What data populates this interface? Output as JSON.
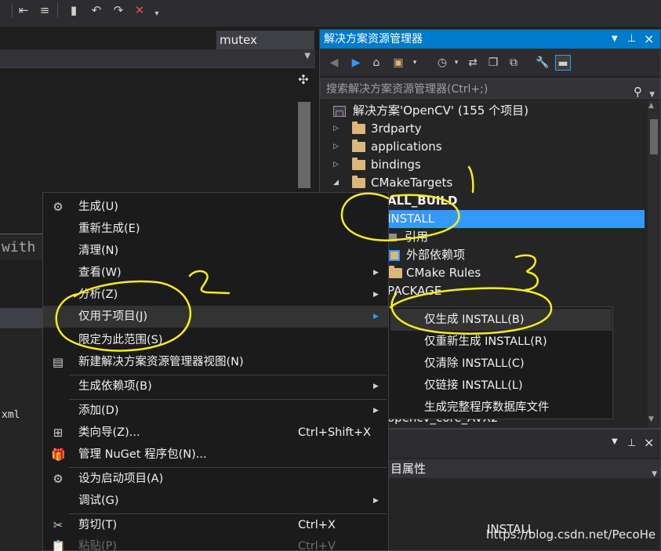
{
  "toolbar": {
    "icons": [
      "indent-icon",
      "comment-icon",
      "bookmark-icon",
      "bookmark-prev-icon",
      "bookmark-next-icon",
      "bookmark-clear-icon",
      "toolbar-overflow-icon"
    ]
  },
  "editor": {
    "tab_label": "mutex",
    "code_fragment": "with",
    "xml_fragment": "xml"
  },
  "solution_explorer": {
    "title": "解决方案资源管理器",
    "search_placeholder": "搜索解决方案资源管理器(Ctrl+;)",
    "tree": [
      {
        "label": "解决方案'OpenCV' (155 个项目)",
        "kind": "solution"
      },
      {
        "label": "3rdparty",
        "kind": "folder"
      },
      {
        "label": "applications",
        "kind": "folder"
      },
      {
        "label": "bindings",
        "kind": "folder"
      },
      {
        "label": "CMakeTargets",
        "kind": "folder"
      },
      {
        "label": "ALL_BUILD",
        "kind": "project"
      },
      {
        "label": "INSTALL",
        "kind": "project",
        "selected": true
      },
      {
        "label": "引用",
        "kind": "references"
      },
      {
        "label": "外部依赖项",
        "kind": "external"
      },
      {
        "label": "CMake Rules",
        "kind": "folder"
      },
      {
        "label": "PACKAGE",
        "kind": "project"
      },
      {
        "label": "opencv_core_AVX2",
        "kind": "project"
      }
    ]
  },
  "properties": {
    "dropdown_label": "目属性",
    "object_name": "INSTALL"
  },
  "context_menu": {
    "items": [
      {
        "label": "生成(U)",
        "icon": "build-icon"
      },
      {
        "label": "重新生成(E)"
      },
      {
        "label": "清理(N)"
      },
      {
        "label": "查看(W)",
        "submenu": true
      },
      {
        "label": "分析(Z)",
        "submenu": true
      },
      {
        "label": "仅用于项目(J)",
        "submenu": true
      },
      {
        "label": "限定为此范围(S)"
      },
      {
        "label": "新建解决方案资源管理器视图(N)",
        "icon": "new-view-icon"
      },
      {
        "label": "生成依赖项(B)",
        "submenu": true
      },
      {
        "label": "添加(D)",
        "submenu": true
      },
      {
        "label": "类向导(Z)...",
        "shortcut": "Ctrl+Shift+X",
        "icon": "class-wizard-icon"
      },
      {
        "label": "管理 NuGet 程序包(N)...",
        "icon": "nuget-icon"
      },
      {
        "label": "设为启动项目(A)",
        "icon": "gear-icon"
      },
      {
        "label": "调试(G)",
        "submenu": true
      },
      {
        "label": "剪切(T)",
        "shortcut": "Ctrl+X",
        "icon": "scissors-icon"
      },
      {
        "label": "粘贴(P)",
        "shortcut": "Ctrl+V",
        "icon": "paste-icon",
        "disabled": true
      }
    ]
  },
  "sub_menu": {
    "items": [
      {
        "label": "仅生成 INSTALL(B)"
      },
      {
        "label": "仅重新生成 INSTALL(R)"
      },
      {
        "label": "仅清除 INSTALL(C)"
      },
      {
        "label": "仅链接 INSTALL(L)"
      },
      {
        "label": "生成完整程序数据库文件"
      }
    ]
  },
  "annotations": {
    "marks": [
      "1",
      "2",
      "3"
    ],
    "color": "#f5ee1a"
  },
  "watermark": "https://blog.csdn.net/PecoHe",
  "colors": {
    "accent": "#007acc",
    "selection": "#3399ff",
    "menu_bg": "#1b1b1c",
    "panel_bg": "#252526"
  }
}
